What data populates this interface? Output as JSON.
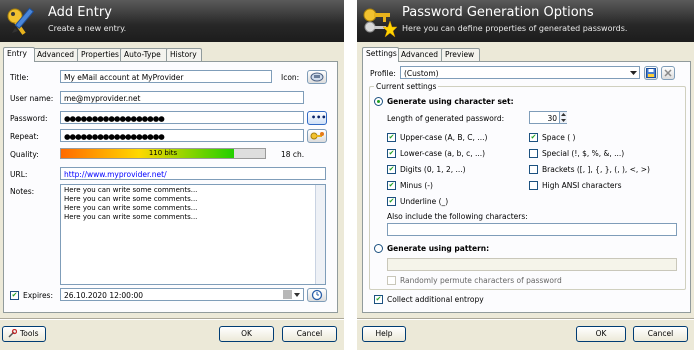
{
  "entry": {
    "title": "Add Entry",
    "subtitle": "Create a new entry.",
    "tabs": [
      "Entry",
      "Advanced",
      "Properties",
      "Auto-Type",
      "History"
    ],
    "fields": {
      "title_label": "Title:",
      "title_value": "My eMail account at MyProvider",
      "icon_label": "Icon:",
      "username_label": "User name:",
      "username_value": "me@myprovider.net",
      "password_label": "Password:",
      "password_value": "●●●●●●●●●●●●●●●●●●",
      "repeat_label": "Repeat:",
      "repeat_value": "●●●●●●●●●●●●●●●●●●",
      "quality_label": "Quality:",
      "quality_text": "110 bits",
      "quality_fraction": 0.85,
      "quality_chars": "18 ch.",
      "url_label": "URL:",
      "url_value": "http://www.myprovider.net/",
      "notes_label": "Notes:",
      "notes_lines": [
        "Here you can write some comments...",
        "Here you can write some comments...",
        "Here you can write some comments...",
        "Here you can write some comments..."
      ],
      "expires_label": "Expires:",
      "expires_value": "26.10.2020 12:00:00",
      "expires_checked": true
    },
    "buttons": {
      "tools": "Tools",
      "ok": "OK",
      "cancel": "Cancel",
      "dots": "•••"
    }
  },
  "pwgen": {
    "title": "Password Generation Options",
    "subtitle": "Here you can define properties of generated passwords.",
    "tabs": [
      "Settings",
      "Advanced",
      "Preview"
    ],
    "profile_label": "Profile:",
    "profile_value": "(Custom)",
    "current_settings": "Current settings",
    "charset_radio": "Generate using character set:",
    "length_label": "Length of generated password:",
    "length_value": "30",
    "options": [
      {
        "label": "Upper-case (A, B, C, ...)",
        "checked": true
      },
      {
        "label": "Space ( )",
        "checked": true
      },
      {
        "label": "Lower-case (a, b, c, ...)",
        "checked": true
      },
      {
        "label": "Special (!, $, %, &, ...)",
        "checked": false
      },
      {
        "label": "Digits (0, 1, 2, ...)",
        "checked": true
      },
      {
        "label": "Brackets ([, ], {, }, (, ), <, >)",
        "checked": false
      },
      {
        "label": "Minus (-)",
        "checked": true
      },
      {
        "label": "High ANSI characters",
        "checked": false
      },
      {
        "label": "Underline (_)",
        "checked": true
      }
    ],
    "also_include_label": "Also include the following characters:",
    "pattern_radio": "Generate using pattern:",
    "permute_label": "Randomly permute characters of password",
    "entropy_label": "Collect additional entropy",
    "buttons": {
      "help": "Help",
      "ok": "OK",
      "cancel": "Cancel"
    },
    "accent_green": "#21a121"
  }
}
